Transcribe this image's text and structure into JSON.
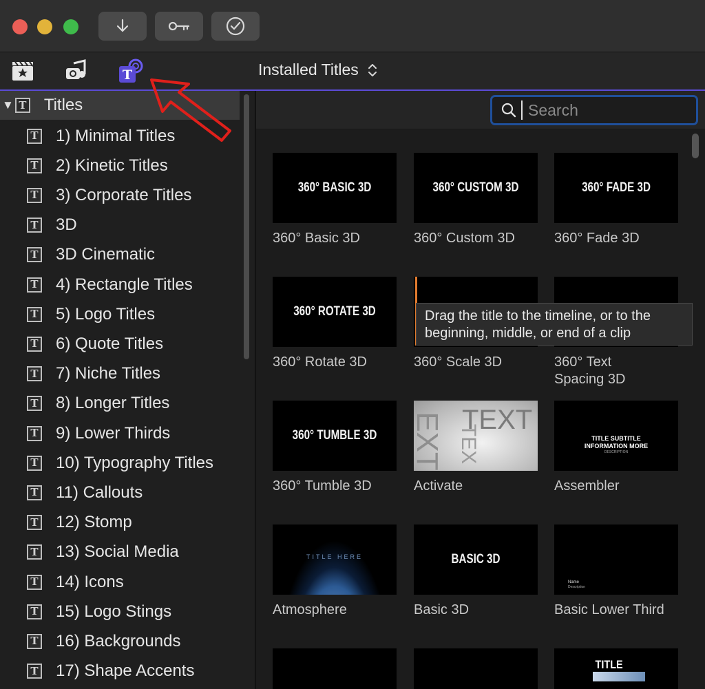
{
  "toolbar": {
    "traffic_lights": [
      "#ec5f57",
      "#e2b33a",
      "#3fbb4b"
    ],
    "buttons": [
      "download-arrow-icon",
      "key-icon",
      "checkmark-icon"
    ]
  },
  "browser_tabs": [
    {
      "icon": "clapperboard-icon"
    },
    {
      "icon": "music-photo-icon"
    },
    {
      "icon": "titles-generators-icon",
      "accent": "#5b4bd6"
    }
  ],
  "library": {
    "title": "Installed Titles"
  },
  "search": {
    "placeholder": "Search"
  },
  "sidebar": {
    "header": "Titles",
    "items": [
      {
        "label": "1) Minimal Titles"
      },
      {
        "label": "2) Kinetic Titles"
      },
      {
        "label": "3) Corporate Titles"
      },
      {
        "label": "3D"
      },
      {
        "label": "3D Cinematic"
      },
      {
        "label": "4) Rectangle Titles"
      },
      {
        "label": "5) Logo Titles"
      },
      {
        "label": "6) Quote Titles"
      },
      {
        "label": "7) Niche Titles"
      },
      {
        "label": "8) Longer Titles"
      },
      {
        "label": "9) Lower Thirds"
      },
      {
        "label": "10) Typography Titles"
      },
      {
        "label": "11) Callouts"
      },
      {
        "label": "12) Stomp"
      },
      {
        "label": "13) Social Media"
      },
      {
        "label": "14) Icons"
      },
      {
        "label": "15) Logo Stings"
      },
      {
        "label": "16) Backgrounds"
      },
      {
        "label": "17) Shape Accents"
      }
    ]
  },
  "tiles": [
    {
      "label": "360° Basic 3D",
      "thumb": "360° BASIC 3D"
    },
    {
      "label": "360° Custom 3D",
      "thumb": "360° CUSTOM 3D"
    },
    {
      "label": "360° Fade 3D",
      "thumb": "360° FADE 3D"
    },
    {
      "label": "360° Rotate 3D",
      "thumb": "360° ROTATE 3D"
    },
    {
      "label": "360° Scale 3D",
      "thumb": ""
    },
    {
      "label": "360° Text Spacing 3D",
      "thumb": ""
    },
    {
      "label": "360° Tumble 3D",
      "thumb": "360° TUMBLE 3D"
    },
    {
      "label": "Activate",
      "thumb": "TEXT"
    },
    {
      "label": "Assembler",
      "thumb": "TITLE SUBTITLE",
      "thumb2": "INFORMATION MORE",
      "thumb3": "DESCRIPTION"
    },
    {
      "label": "Atmosphere",
      "thumb": "TITLE HERE"
    },
    {
      "label": "Basic 3D",
      "thumb": "BASIC 3D"
    },
    {
      "label": "Basic Lower Third",
      "thumb": "Name",
      "thumb2": "Description"
    },
    {
      "label": "",
      "thumb": ""
    },
    {
      "label": "",
      "thumb": ""
    },
    {
      "label": "",
      "thumb": "TITLE"
    }
  ],
  "tooltip": {
    "text": "Drag the title to the timeline, or to the beginning, middle, or end of a clip"
  },
  "annotation": {
    "color": "#e0201b",
    "icon": "red-arrow-annotation"
  }
}
